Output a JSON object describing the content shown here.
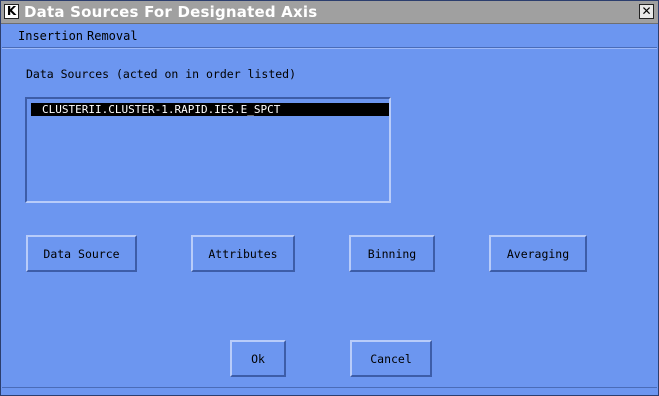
{
  "window": {
    "title": "Data Sources For Designated Axis",
    "app_icon": "K",
    "close_icon": "✕"
  },
  "menu": {
    "items": [
      "Insertion",
      "Removal"
    ]
  },
  "data_sources": {
    "label": "Data Sources (acted on in order listed)",
    "items": [
      "CLUSTERII.CLUSTER-1.RAPID.IES.E_SPCT"
    ],
    "selected_index": 0
  },
  "buttons": {
    "data_source": "Data Source",
    "attributes": "Attributes",
    "binning": "Binning",
    "averaging": "Averaging",
    "ok": "Ok",
    "cancel": "Cancel"
  },
  "colors": {
    "background": "#6c96f0",
    "titlebar": "#a0a0a0",
    "selection": "#000000"
  }
}
